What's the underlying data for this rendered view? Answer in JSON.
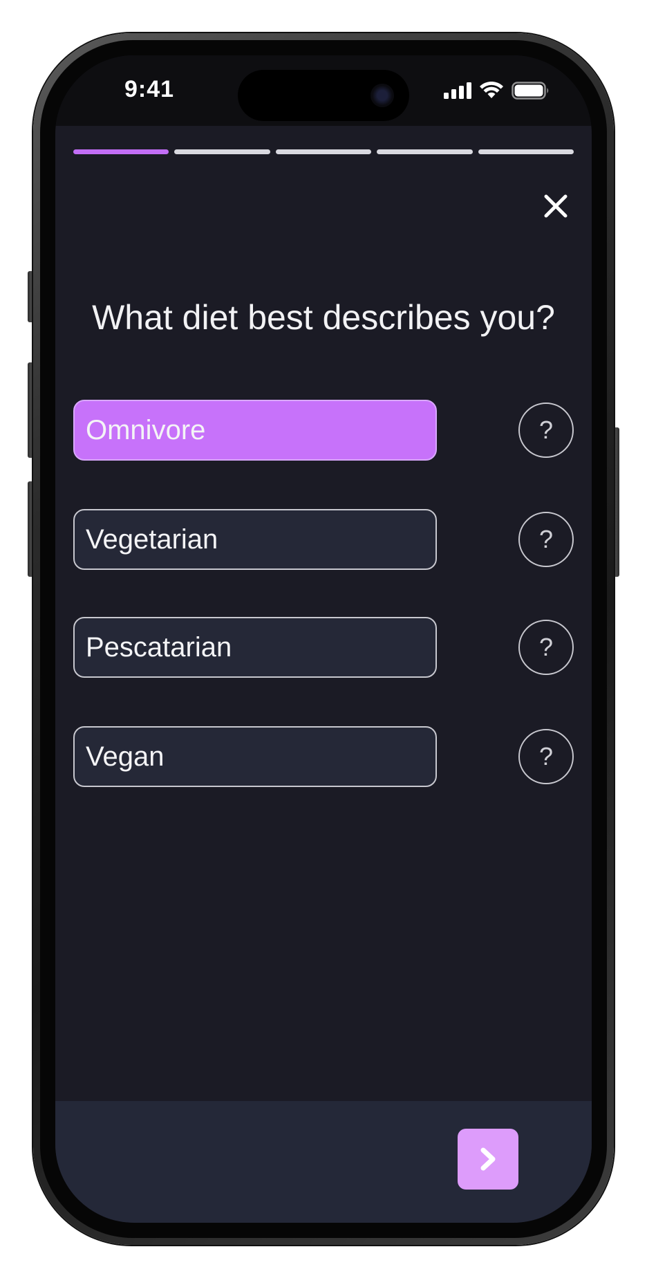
{
  "status_bar": {
    "time": "9:41",
    "icons": [
      "signal-icon",
      "wifi-icon",
      "battery-icon"
    ]
  },
  "progress": {
    "total_steps": 5,
    "current_step": 1
  },
  "question": "What diet best describes you?",
  "options": [
    {
      "label": "Omnivore",
      "selected": true
    },
    {
      "label": "Vegetarian",
      "selected": false
    },
    {
      "label": "Pescatarian",
      "selected": false
    },
    {
      "label": "Vegan",
      "selected": false
    }
  ],
  "help_label": "?",
  "colors": {
    "accent": "#c772fa",
    "next_button": "#dd9cfb",
    "background": "#1b1b25",
    "option_background": "#252837"
  },
  "icons": {
    "close": "close-icon",
    "next": "chevron-right-icon"
  }
}
